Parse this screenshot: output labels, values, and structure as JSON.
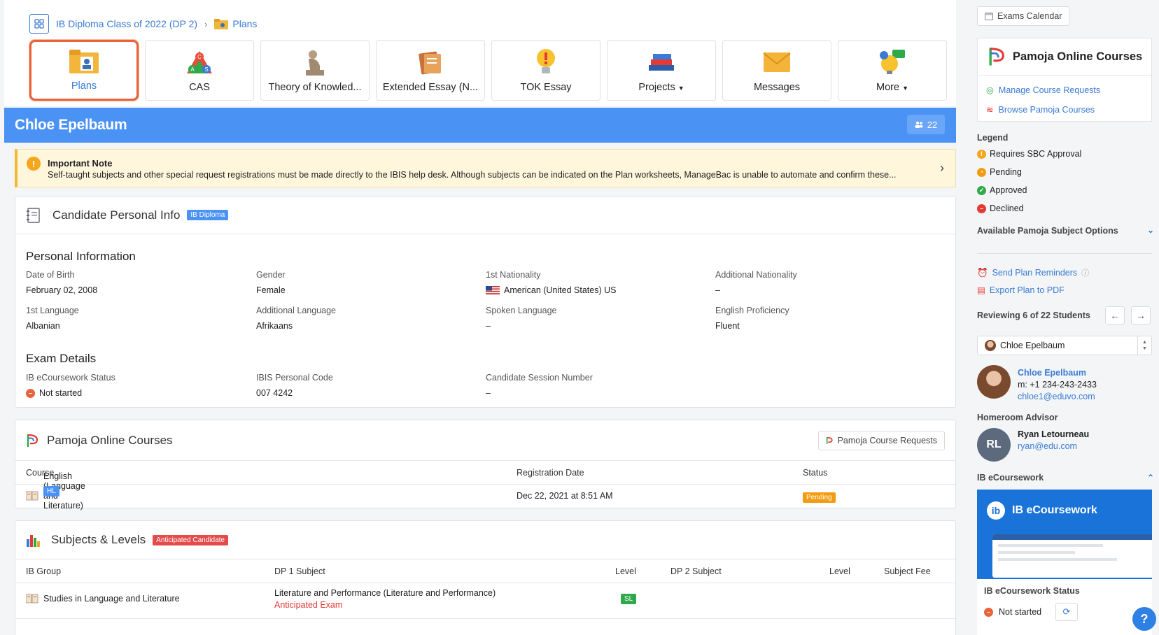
{
  "breadcrumb": {
    "class_name": "IB Diploma Class of 2022 (DP 2)",
    "current": "Plans"
  },
  "tabs": [
    {
      "label": "Plans",
      "icon": "plans-icon"
    },
    {
      "label": "CAS",
      "icon": "cas-icon"
    },
    {
      "label": "Theory of Knowled...",
      "icon": "thinker-icon"
    },
    {
      "label": "Extended Essay (N...",
      "icon": "essay-icon"
    },
    {
      "label": "TOK Essay",
      "icon": "lightbulb-icon"
    },
    {
      "label": "Projects",
      "icon": "books-icon"
    },
    {
      "label": "Messages",
      "icon": "envelope-icon"
    },
    {
      "label": "More",
      "icon": "more-icon"
    }
  ],
  "student": {
    "name": "Chloe Epelbaum",
    "count": "22"
  },
  "note": {
    "title": "Important Note",
    "text": "Self-taught subjects and other special request registrations must be made directly to the IBIS help desk. Although subjects can be indicated on the Plan worksheets, ManageBac is unable to automate and confirm these..."
  },
  "personal_card": {
    "title": "Candidate Personal Info",
    "badge": "IB Diploma",
    "personal_heading": "Personal Information",
    "fields": [
      {
        "label": "Date of Birth",
        "value": "February 02, 2008"
      },
      {
        "label": "Gender",
        "value": "Female"
      },
      {
        "label": "1st Nationality",
        "value": "American (United States) US"
      },
      {
        "label": "Additional Nationality",
        "value": "–"
      },
      {
        "label": "1st Language",
        "value": "Albanian"
      },
      {
        "label": "Additional Language",
        "value": "Afrikaans"
      },
      {
        "label": "Spoken Language",
        "value": "–"
      },
      {
        "label": "English Proficiency",
        "value": "Fluent"
      }
    ],
    "exam_heading": "Exam Details",
    "exam_fields": [
      {
        "label": "IB eCoursework Status",
        "value": "Not started"
      },
      {
        "label": "IBIS Personal Code",
        "value": "007 4242"
      },
      {
        "label": "Candidate Session Number",
        "value": "–"
      }
    ]
  },
  "pamoja_card": {
    "title": "Pamoja Online Courses",
    "button": "Pamoja Course Requests",
    "columns": [
      "Course",
      "Registration Date",
      "Status"
    ],
    "rows": [
      {
        "course": "English (Language and Literature)",
        "level": "HL",
        "date": "Dec 22, 2021 at 8:51 AM",
        "status": "Pending"
      }
    ]
  },
  "subjects_card": {
    "title": "Subjects & Levels",
    "badge": "Anticipated Candidate",
    "columns": [
      "IB Group",
      "DP 1 Subject",
      "Level",
      "DP 2 Subject",
      "Level",
      "Subject Fee"
    ],
    "rows": [
      {
        "group": "Studies in Language and Literature",
        "subject": "Literature and Performance (Literature and Performance)",
        "note": "Anticipated Exam",
        "level": "SL"
      }
    ]
  },
  "sidebar": {
    "exams_calendar": "Exams Calendar",
    "pamoja_brand": "Pamoja Online Courses",
    "manage_requests": "Manage Course Requests",
    "browse_courses": "Browse Pamoja Courses",
    "legend_title": "Legend",
    "legend": [
      {
        "label": "Requires SBC Approval",
        "color": "#f4a71c",
        "glyph": "!"
      },
      {
        "label": "Pending",
        "color": "#f39c12",
        "glyph": "◔"
      },
      {
        "label": "Approved",
        "color": "#2fa94a",
        "glyph": "✓"
      },
      {
        "label": "Declined",
        "color": "#e53935",
        "glyph": "–"
      }
    ],
    "available_options": "Available Pamoja Subject Options",
    "send_reminders": "Send Plan Reminders",
    "export_pdf": "Export Plan to PDF",
    "reviewing": "Reviewing 6 of 22 Students",
    "selected_student": "Chloe Epelbaum",
    "student_name": "Chloe Epelbaum",
    "student_phone": "m: +1 234-243-2433",
    "student_email": "chloe1@eduvo.com",
    "advisor_heading": "Homeroom Advisor",
    "advisor_initials": "RL",
    "advisor_name": "Ryan Letourneau",
    "advisor_email": "ryan@edu.com",
    "ecw_heading": "IB eCoursework",
    "ecw_banner": "IB eCoursework",
    "ecw_status_label": "IB eCoursework Status",
    "ecw_status": "Not started",
    "help": "?"
  }
}
